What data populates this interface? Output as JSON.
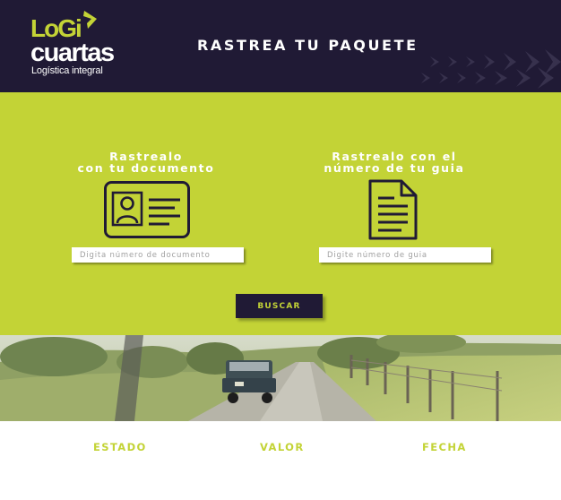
{
  "brand": {
    "logo_line1": "LoGi",
    "logo_line2": "cuartas",
    "logo_line3": "Logística integral",
    "colors": {
      "primary_dark": "#201a35",
      "accent_green": "#c3d336"
    }
  },
  "header": {
    "title": "RASTREA TU PAQUETE"
  },
  "track_document": {
    "title_line1": "Rastrealo",
    "title_line2": "con tu documento",
    "icon": "id-card-icon",
    "input_placeholder": "Digita número de documento",
    "input_value": ""
  },
  "track_guide": {
    "title_line1": "Rastrealo con el",
    "title_line2": "número de tu guia",
    "icon": "document-icon",
    "input_placeholder": "Digite número de guia",
    "input_value": ""
  },
  "search_button": {
    "label": "BUSCAR"
  },
  "results": {
    "columns": [
      "ESTADO",
      "VALOR",
      "FECHA"
    ]
  }
}
